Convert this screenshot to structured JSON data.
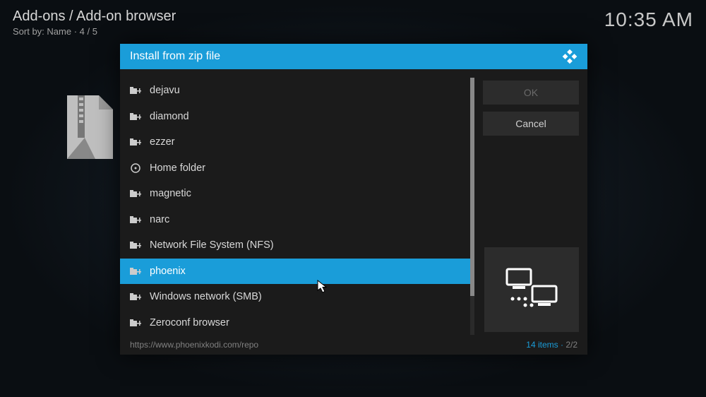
{
  "header": {
    "breadcrumb": "Add-ons / Add-on browser",
    "sortby": "Sort by: Name  ·  4 / 5",
    "clock": "10:35 AM"
  },
  "dialog": {
    "title": "Install from zip file",
    "buttons": {
      "ok": "OK",
      "cancel": "Cancel"
    },
    "footer": {
      "path": "https://www.phoenixkodi.com/repo",
      "items_count": "14 items",
      "page": "2/2"
    }
  },
  "list": [
    {
      "label": "dejavu",
      "icon": "net-folder",
      "selected": false
    },
    {
      "label": "diamond",
      "icon": "net-folder",
      "selected": false
    },
    {
      "label": "ezzer",
      "icon": "net-folder",
      "selected": false
    },
    {
      "label": "Home folder",
      "icon": "disk",
      "selected": false
    },
    {
      "label": "magnetic",
      "icon": "net-folder",
      "selected": false
    },
    {
      "label": "narc",
      "icon": "net-folder",
      "selected": false
    },
    {
      "label": "Network File System (NFS)",
      "icon": "net-folder",
      "selected": false
    },
    {
      "label": "phoenix",
      "icon": "net-folder",
      "selected": true
    },
    {
      "label": "Windows network (SMB)",
      "icon": "net-folder",
      "selected": false
    },
    {
      "label": "Zeroconf browser",
      "icon": "net-folder",
      "selected": false
    }
  ],
  "colors": {
    "accent": "#1a9dd9",
    "panel": "#1b1b1b",
    "button": "#2c2c2c"
  }
}
